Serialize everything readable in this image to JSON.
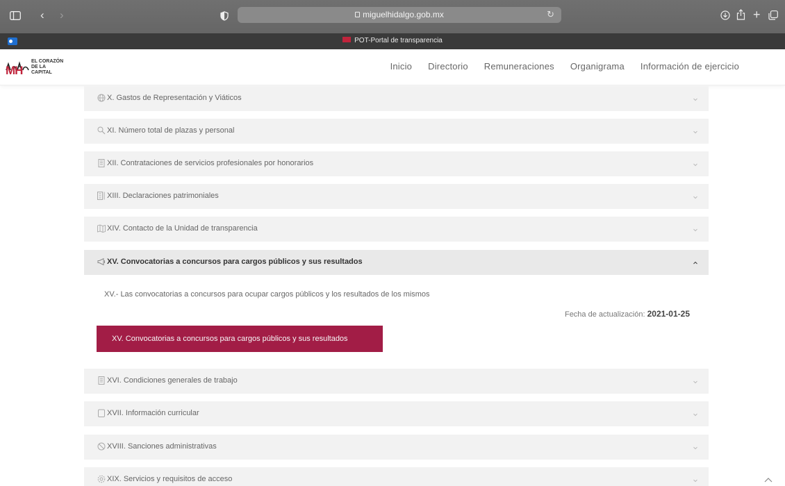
{
  "browser": {
    "url": "miguelhidalgo.gob.mx",
    "tab_title": "POT-Portal de transparencia"
  },
  "site": {
    "logo": {
      "line1": "EL CORAZÓN",
      "line2": "DE LA",
      "line3": "CAPITAL",
      "mark": "MH"
    },
    "nav": [
      {
        "label": "Inicio"
      },
      {
        "label": "Directorio"
      },
      {
        "label": "Remuneraciones"
      },
      {
        "label": "Organigrama"
      },
      {
        "label": "Información de ejercicio"
      }
    ]
  },
  "accordion": {
    "items": [
      {
        "label": "X. Gastos de Representación y Viáticos",
        "icon": "globe-icon",
        "expanded": false
      },
      {
        "label": "XI. Número total de plazas y personal",
        "icon": "magnifier-icon",
        "expanded": false
      },
      {
        "label": "XII. Contrataciones de servicios profesionales por honorarios",
        "icon": "document-icon",
        "expanded": false
      },
      {
        "label": "XIII. Declaraciones patrimoniales",
        "icon": "cabinet-icon",
        "expanded": false
      },
      {
        "label": "XIV. Contacto de la Unidad de transparencia",
        "icon": "map-icon",
        "expanded": false
      },
      {
        "label": "XV. Convocatorias a concursos para cargos públicos y sus resultados",
        "icon": "megaphone-icon",
        "expanded": true
      },
      {
        "label": "XVI. Condiciones generales de trabajo",
        "icon": "document-icon",
        "expanded": false
      },
      {
        "label": "XVII. Información curricular",
        "icon": "folder-icon",
        "expanded": false
      },
      {
        "label": "XVIII. Sanciones administrativas",
        "icon": "prohibited-icon",
        "expanded": false
      },
      {
        "label": "XIX. Servicios y requisitos de acceso",
        "icon": "gear-icon",
        "expanded": false
      }
    ],
    "open_panel": {
      "description": "XV.- Las convocatorias a concursos para ocupar cargos públicos y los resultados de los mismos",
      "date_label": "Fecha de actualización:",
      "date_value": "2021-01-25",
      "button_label": "XV. Convocatorias a concursos para cargos públicos y sus resultados"
    }
  },
  "colors": {
    "accent": "#a21d46",
    "brand_red": "#c0243c",
    "row_bg": "#f2f2f2"
  }
}
